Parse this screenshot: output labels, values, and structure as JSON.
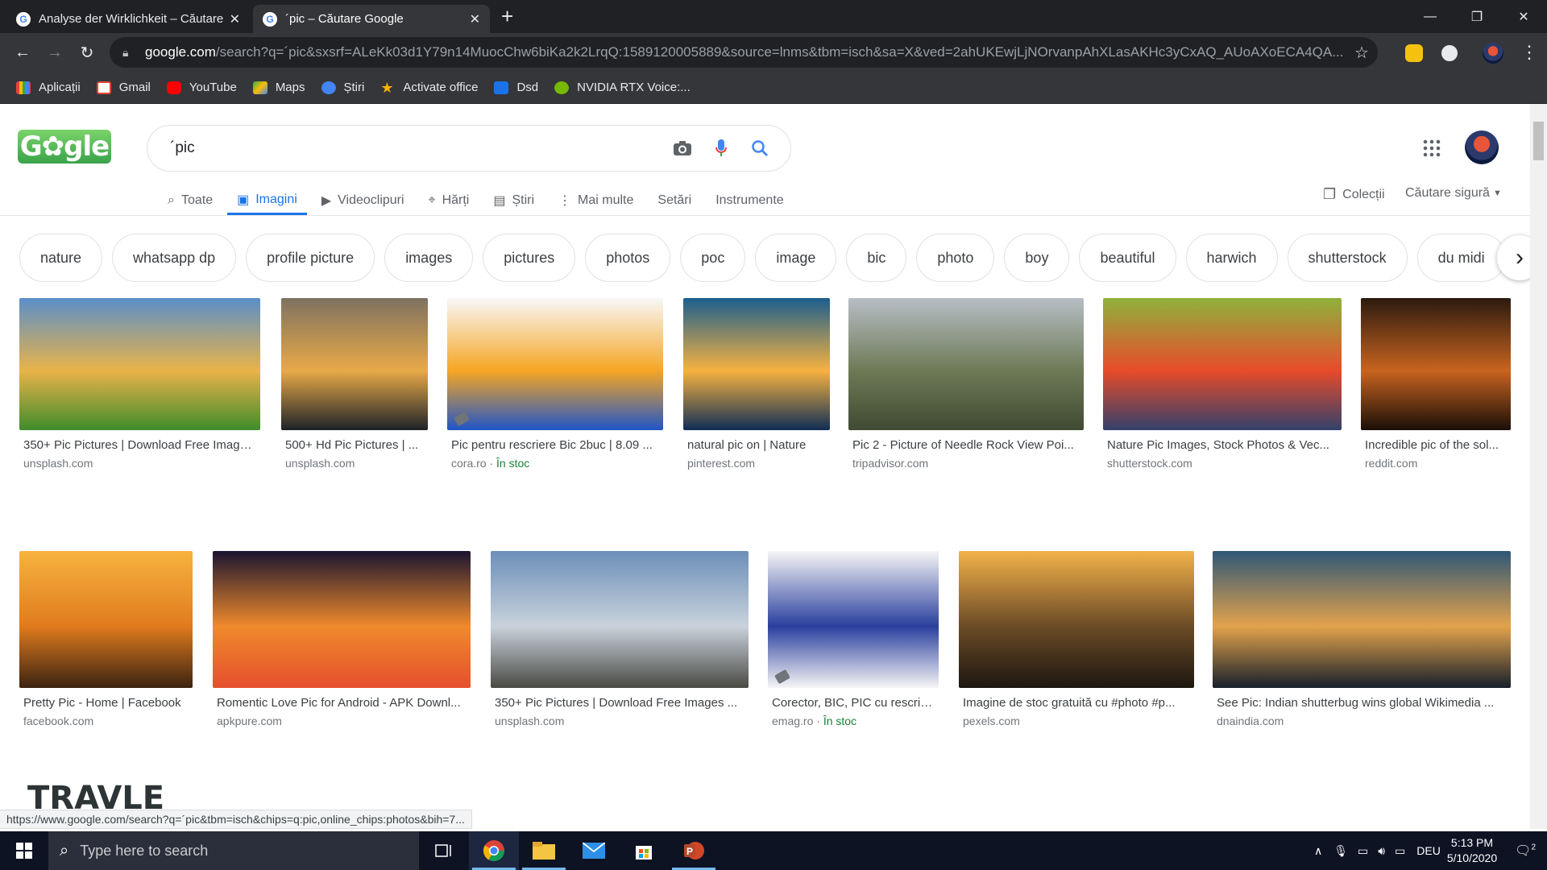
{
  "tabs": [
    {
      "title": "Analyse der Wirklichkeit – Căutare",
      "active": false
    },
    {
      "title": "´pic – Căutare Google",
      "active": true
    }
  ],
  "window_controls": {
    "minimize": "—",
    "restore": "❐",
    "close": "✕"
  },
  "address_bar": {
    "host": "google.com",
    "path": "/search?q=´pic&sxsrf=ALeKk03d1Y79n14MuocChw6biKa2k2LrqQ:1589120005889&source=lnms&tbm=isch&sa=X&ved=2ahUKEwjLjNOrvanpAhXLasAKHc3yCxAQ_AUoAXoECA4QA..."
  },
  "bookmarks": [
    {
      "label": "Aplicații",
      "icon": "apps-grid-icon",
      "color": "#ea4335"
    },
    {
      "label": "Gmail",
      "icon": "gmail-icon",
      "color": "#ea4335"
    },
    {
      "label": "YouTube",
      "icon": "youtube-icon",
      "color": "#ff0000"
    },
    {
      "label": "Maps",
      "icon": "maps-icon",
      "color": "#34a853"
    },
    {
      "label": "Știri",
      "icon": "news-icon",
      "color": "#4285f4"
    },
    {
      "label": "Activate office",
      "icon": "star-icon",
      "color": "#f4b400"
    },
    {
      "label": "Dsd",
      "icon": "dsd-icon",
      "color": "#1a73e8"
    },
    {
      "label": "NVIDIA RTX Voice:...",
      "icon": "nvidia-icon",
      "color": "#76b900"
    }
  ],
  "search": {
    "query": "´pic"
  },
  "nav_tabs": [
    {
      "label": "Toate",
      "icon": "search-icon"
    },
    {
      "label": "Imagini",
      "icon": "image-icon",
      "active": true
    },
    {
      "label": "Videoclipuri",
      "icon": "video-icon"
    },
    {
      "label": "Hărți",
      "icon": "map-pin-icon"
    },
    {
      "label": "Știri",
      "icon": "news-icon"
    },
    {
      "label": "Mai multe",
      "icon": "more-vert-icon"
    },
    {
      "label": "Setări"
    },
    {
      "label": "Instrumente"
    }
  ],
  "nav_right": {
    "collections": "Colecții",
    "safe_search": "Căutare sigură"
  },
  "chips": [
    "nature",
    "whatsapp dp",
    "profile picture",
    "images",
    "pictures",
    "photos",
    "poc",
    "image",
    "bic",
    "photo",
    "boy",
    "beautiful",
    "harwich",
    "shutterstock",
    "du midi"
  ],
  "results_row1": [
    {
      "caption": "350+ Pic Pictures | Download Free Images ...",
      "source": "unsplash.com",
      "colors": [
        "#5a8fc9",
        "#e9b34a",
        "#3f8c2a"
      ]
    },
    {
      "caption": "500+ Hd Pic Pictures | ...",
      "source": "unsplash.com",
      "colors": [
        "#7e7260",
        "#e8a948",
        "#1d2228"
      ]
    },
    {
      "caption": "Pic pentru rescriere Bic 2buc | 8.09 ...",
      "source": "cora.ro",
      "stock": "În stoc",
      "colors": [
        "#f8f8f8",
        "#f6a623",
        "#1f55c8"
      ]
    },
    {
      "caption": "natural pic on | Nature",
      "source": "pinterest.com",
      "colors": [
        "#1c5e8e",
        "#f6b240",
        "#0f2e55"
      ]
    },
    {
      "caption": "Pic 2 - Picture of Needle Rock View Poi...",
      "source": "tripadvisor.com",
      "colors": [
        "#b7bec5",
        "#6d7a55",
        "#414a33"
      ]
    },
    {
      "caption": "Nature Pic Images, Stock Photos & Vec...",
      "source": "shutterstock.com",
      "colors": [
        "#8fb23c",
        "#e84b2a",
        "#32416b"
      ]
    },
    {
      "caption": "Incredible pic of the sol...",
      "source": "reddit.com",
      "colors": [
        "#2b1a0f",
        "#c8641f",
        "#1a0f08"
      ]
    }
  ],
  "results_row2": [
    {
      "caption": "Pretty Pic - Home | Facebook",
      "source": "facebook.com",
      "colors": [
        "#f7b33e",
        "#e07b1e",
        "#3b2310"
      ]
    },
    {
      "caption": "Romentic Love Pic for Android - APK Downl...",
      "source": "apkpure.com",
      "colors": [
        "#1a1430",
        "#f08a2c",
        "#e54f2d"
      ]
    },
    {
      "caption": "350+ Pic Pictures | Download Free Images ...",
      "source": "unsplash.com",
      "colors": [
        "#6b8fb8",
        "#c9d2dc",
        "#4a4a44"
      ]
    },
    {
      "caption": "Corector, BIC, PIC cu rescrie...",
      "source": "emag.ro",
      "stock": "În stoc",
      "colors": [
        "#f6f6f6",
        "#2a3f9e",
        "#f6f6f6"
      ]
    },
    {
      "caption": "Imagine de stoc gratuită cu #photo #p...",
      "source": "pexels.com",
      "colors": [
        "#f3b24a",
        "#6b4b26",
        "#1d1710"
      ]
    },
    {
      "caption": "See Pic: Indian shutterbug wins global Wikimedia ...",
      "source": "dnaindia.com",
      "colors": [
        "#2e5777",
        "#e3a24c",
        "#16202b"
      ]
    }
  ],
  "results_row3": [
    {
      "text": "TRAVLE",
      "colors": [
        "#6b7a7e",
        "#4b5659"
      ]
    },
    {
      "colors": [
        "#f2f2f2",
        "#e0e0e0"
      ]
    },
    {
      "colors": [
        "#3c6b73",
        "#d98a3a"
      ]
    },
    {
      "colors": [
        "#3a5c7a",
        "#9ec3e3"
      ]
    },
    {
      "colors": [
        "#2c3e66",
        "#e8744a"
      ]
    },
    {
      "colors": [
        "#5a86c4",
        "#6d9a3f"
      ]
    },
    {
      "colors": [
        "#2a2a2a",
        "#5a5a5a"
      ]
    }
  ],
  "status_url": "https://www.google.com/search?q=´pic&tbm=isch&chips=q:pic,online_chips:photos&bih=7...",
  "taskbar": {
    "search_placeholder": "Type here to search",
    "language": "DEU",
    "time": "5:13 PM",
    "date": "5/10/2020",
    "notifications": "2"
  }
}
